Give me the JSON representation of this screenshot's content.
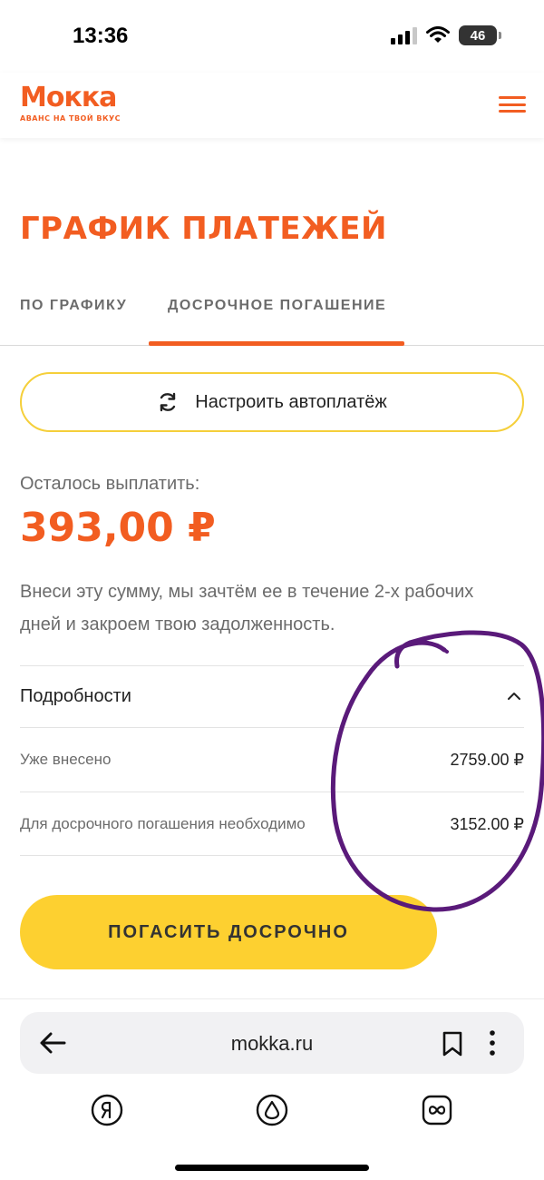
{
  "status_bar": {
    "time": "13:36",
    "battery": "46"
  },
  "header": {
    "logo_name": "Мокка",
    "logo_tagline": "АВАНС НА ТВОЙ ВКУС",
    "menu_icon": "hamburger-menu-icon"
  },
  "page": {
    "title": "ГРАФИК ПЛАТЕЖЕЙ",
    "tabs": [
      {
        "label": "ПО ГРАФИКУ",
        "active": false
      },
      {
        "label": "ДОСРОЧНОЕ ПОГАШЕНИЕ",
        "active": true
      }
    ],
    "autopay_label": "Настроить автоплатёж",
    "remaining_label": "Осталось выплатить:",
    "remaining_amount": "393,00 ₽",
    "info_text": "Внеси эту сумму, мы зачтём ее в течение 2-х рабочих дней и закроем твою задолженность.",
    "details": {
      "title": "Подробности",
      "rows": [
        {
          "label": "Уже внесено",
          "value": "2759.00 ₽"
        },
        {
          "label": "Для досрочного погашения необходимо",
          "value": "3152.00 ₽"
        }
      ]
    },
    "primary_button_label": "ПОГАСИТЬ ДОСРОЧНО"
  },
  "browser": {
    "url": "mokka.ru"
  },
  "colors": {
    "brand_orange": "#f25d21",
    "button_yellow": "#fdd030",
    "annotation_purple": "#5a1a7a"
  }
}
